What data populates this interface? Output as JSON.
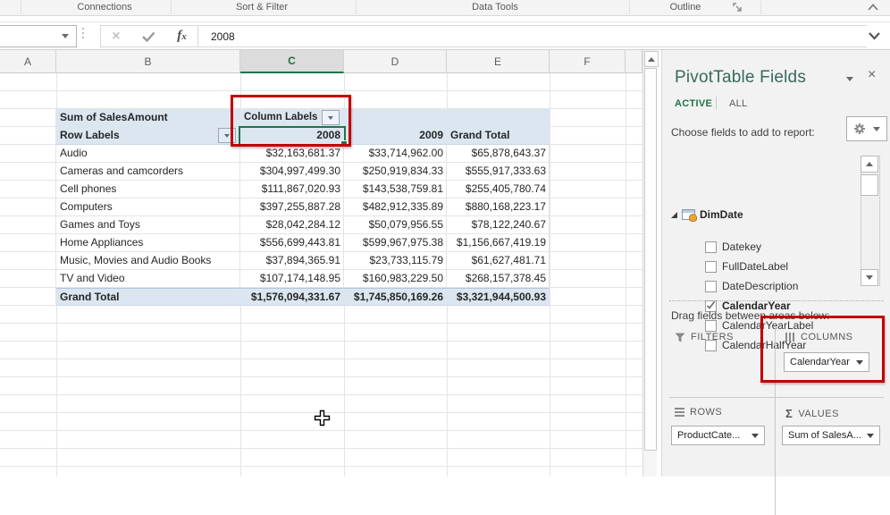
{
  "ribbon": {
    "groups": [
      "Connections",
      "Sort & Filter",
      "Data Tools",
      "Outline"
    ]
  },
  "formula_bar": {
    "value": "2008",
    "cancel_glyph": "×"
  },
  "sheet": {
    "column_headers": [
      "A",
      "B",
      "C",
      "D",
      "E",
      "F"
    ],
    "selected_column": "C"
  },
  "pivot": {
    "sum_label": "Sum of SalesAmount",
    "column_labels": "Column Labels",
    "row_labels": "Row Labels",
    "year_headers": [
      "2008",
      "2009"
    ],
    "grand_total_header": "Grand Total",
    "rows": [
      {
        "label": "Audio",
        "y2008": "$32,163,681.37",
        "y2009": "$33,714,962.00",
        "total": "$65,878,643.37"
      },
      {
        "label": "Cameras and camcorders",
        "y2008": "$304,997,499.30",
        "y2009": "$250,919,834.33",
        "total": "$555,917,333.63"
      },
      {
        "label": "Cell phones",
        "y2008": "$111,867,020.93",
        "y2009": "$143,538,759.81",
        "total": "$255,405,780.74"
      },
      {
        "label": "Computers",
        "y2008": "$397,255,887.28",
        "y2009": "$482,912,335.89",
        "total": "$880,168,223.17"
      },
      {
        "label": "Games and Toys",
        "y2008": "$28,042,284.12",
        "y2009": "$50,079,956.55",
        "total": "$78,122,240.67"
      },
      {
        "label": "Home Appliances",
        "y2008": "$556,699,443.81",
        "y2009": "$599,967,975.38",
        "total": "$1,156,667,419.19"
      },
      {
        "label": "Music, Movies and Audio Books",
        "y2008": "$37,894,365.91",
        "y2009": "$23,733,115.79",
        "total": "$61,627,481.71"
      },
      {
        "label": "TV and Video",
        "y2008": "$107,174,148.95",
        "y2009": "$160,983,229.50",
        "total": "$268,157,378.45"
      }
    ],
    "grand_total": {
      "label": "Grand Total",
      "y2008": "$1,576,094,331.67",
      "y2009": "$1,745,850,169.26",
      "total": "$3,321,944,500.93"
    }
  },
  "fields_panel": {
    "title": "PivotTable Fields",
    "tab_active": "ACTIVE",
    "tab_all": "ALL",
    "close_glyph": "×",
    "choose_label": "Choose fields to add to report:",
    "table_name": "DimDate",
    "fields": [
      {
        "name": "Datekey",
        "checked": false
      },
      {
        "name": "FullDateLabel",
        "checked": false
      },
      {
        "name": "DateDescription",
        "checked": false
      },
      {
        "name": "CalendarYear",
        "checked": true
      },
      {
        "name": "CalendarYearLabel",
        "checked": false
      },
      {
        "name": "CalendarHalfYear",
        "checked": false
      }
    ],
    "drag_label": "Drag fields between areas below:",
    "areas": {
      "filters": {
        "label": "FILTERS",
        "items": []
      },
      "columns": {
        "label": "COLUMNS",
        "items": [
          "CalendarYear"
        ]
      },
      "rows": {
        "label": "ROWS",
        "items": [
          "ProductCate..."
        ]
      },
      "values": {
        "label": "VALUES",
        "items": [
          "Sum of SalesA...",
          "Σ"
        ]
      }
    }
  },
  "colors": {
    "accent_green": "#217346",
    "highlight_red": "#c00000",
    "pivot_band": "#dce6f1",
    "pane_bg": "#f2f2f2"
  }
}
